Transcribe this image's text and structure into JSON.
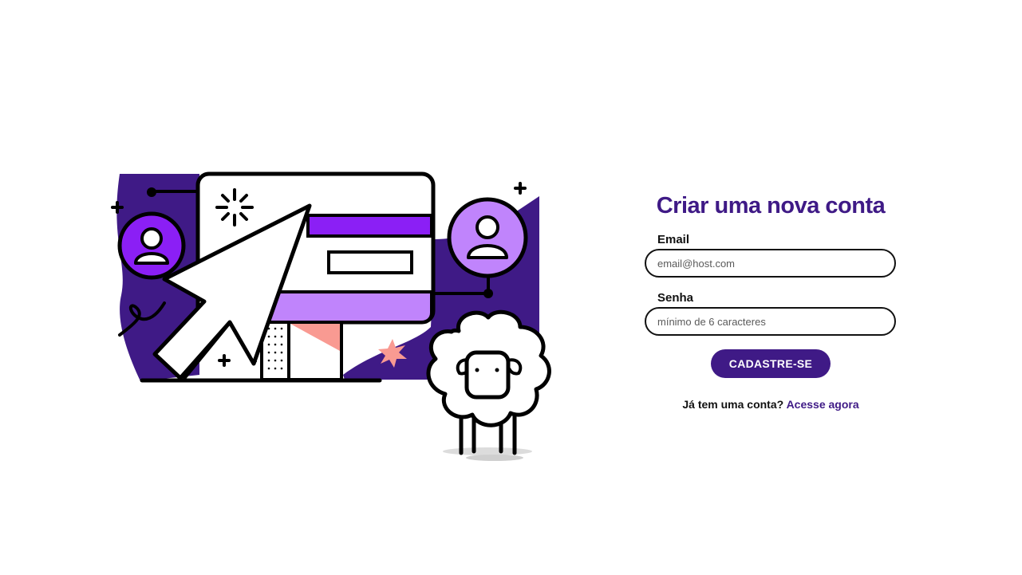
{
  "form": {
    "title": "Criar uma nova conta",
    "email": {
      "label": "Email",
      "placeholder": "email@host.com",
      "value": ""
    },
    "password": {
      "label": "Senha",
      "placeholder": "mínimo de 6 caracteres",
      "value": ""
    },
    "submit_label": "CADASTRE-SE",
    "login_prompt": "Já tem uma conta?",
    "login_link": "Acesse agora"
  },
  "colors": {
    "brand_dark": "#3f1a86",
    "brand_purple": "#8b1ff5",
    "lavender": "#c084fc",
    "coral": "#f99a92"
  },
  "illustration": {
    "icons": [
      "mouse-cursor-icon",
      "user-avatar-icon",
      "sparkle-icon",
      "plus-icon",
      "star-burst-icon",
      "sheep-mascot"
    ]
  }
}
